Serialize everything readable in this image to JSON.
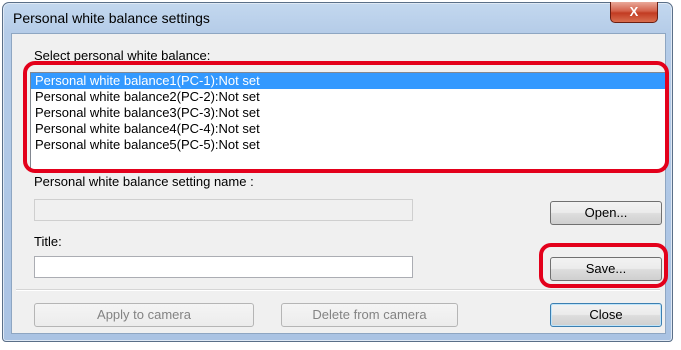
{
  "window": {
    "title": "Personal white balance settings",
    "close_glyph": "X"
  },
  "list": {
    "label": "Select personal white balance:",
    "items": [
      "Personal white balance1(PC-1):Not set",
      "Personal white balance2(PC-2):Not set",
      "Personal white balance3(PC-3):Not set",
      "Personal white balance4(PC-4):Not set",
      "Personal white balance5(PC-5):Not set"
    ],
    "selected_index": 0
  },
  "setting_name": {
    "label": "Personal white balance setting name :",
    "value": ""
  },
  "title_field": {
    "label": "Title:",
    "value": ""
  },
  "buttons": {
    "open": "Open...",
    "save": "Save...",
    "apply": "Apply to camera",
    "delete": "Delete from camera",
    "close": "Close"
  },
  "colors": {
    "highlight": "#e3001b",
    "selection": "#3399ff"
  }
}
